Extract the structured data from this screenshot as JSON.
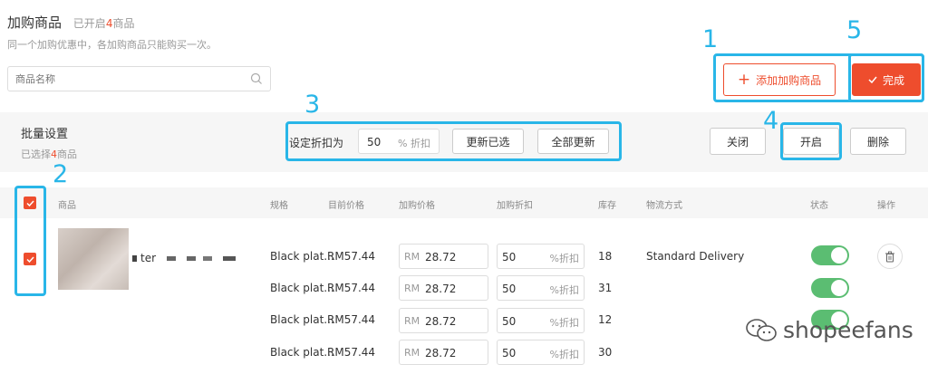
{
  "header": {
    "title": "加购商品",
    "sub_prefix": "已开启",
    "sub_count": "4",
    "sub_suffix": "商品",
    "description": "同一个加购优惠中，各加购商品只能购买一次。"
  },
  "search": {
    "placeholder": "商品名称"
  },
  "actions": {
    "add_label": "添加加购商品",
    "done_label": "完成"
  },
  "batch": {
    "title": "批量设置",
    "selected_prefix": "已选择",
    "selected_count": "4",
    "selected_suffix": "商品",
    "discount_label": "设定折扣为",
    "discount_value": "50",
    "discount_suffix": "% 折扣",
    "update_selected_label": "更新已选",
    "update_all_label": "全部更新",
    "close_label": "关闭",
    "enable_label": "开启",
    "delete_label": "删除"
  },
  "table": {
    "headers": [
      "商品",
      "规格",
      "目前价格",
      "加购价格",
      "加购折扣",
      "库存",
      "物流方式",
      "状态",
      "操作"
    ],
    "product_name": "ter",
    "price_prefix": "RM",
    "discount_suffix": "%折扣",
    "rows": [
      {
        "variation": "Black plat...",
        "current_price": "RM57.44",
        "addon_price": "28.72",
        "discount": "50",
        "stock": "18",
        "shipping": "Standard Delivery",
        "status_on": true
      },
      {
        "variation": "Black plat...",
        "current_price": "RM57.44",
        "addon_price": "28.72",
        "discount": "50",
        "stock": "31",
        "shipping": "",
        "status_on": true
      },
      {
        "variation": "Black plat...",
        "current_price": "RM57.44",
        "addon_price": "28.72",
        "discount": "50",
        "stock": "12",
        "shipping": "",
        "status_on": true
      },
      {
        "variation": "Black plat...",
        "current_price": "RM57.44",
        "addon_price": "28.72",
        "discount": "50",
        "stock": "30",
        "shipping": "",
        "status_on": true
      }
    ]
  },
  "annotations": {
    "n1": "1",
    "n2": "2",
    "n3": "3",
    "n4": "4",
    "n5": "5"
  },
  "watermark": {
    "text": "shopeefans"
  },
  "colors": {
    "accent": "#ee4d2d",
    "highlight": "#29b6e8",
    "toggle_on": "#5bbd72"
  },
  "icons": [
    "search-icon",
    "plus-icon",
    "check-icon",
    "checkbox-icon",
    "trash-icon",
    "wechat-icon"
  ]
}
